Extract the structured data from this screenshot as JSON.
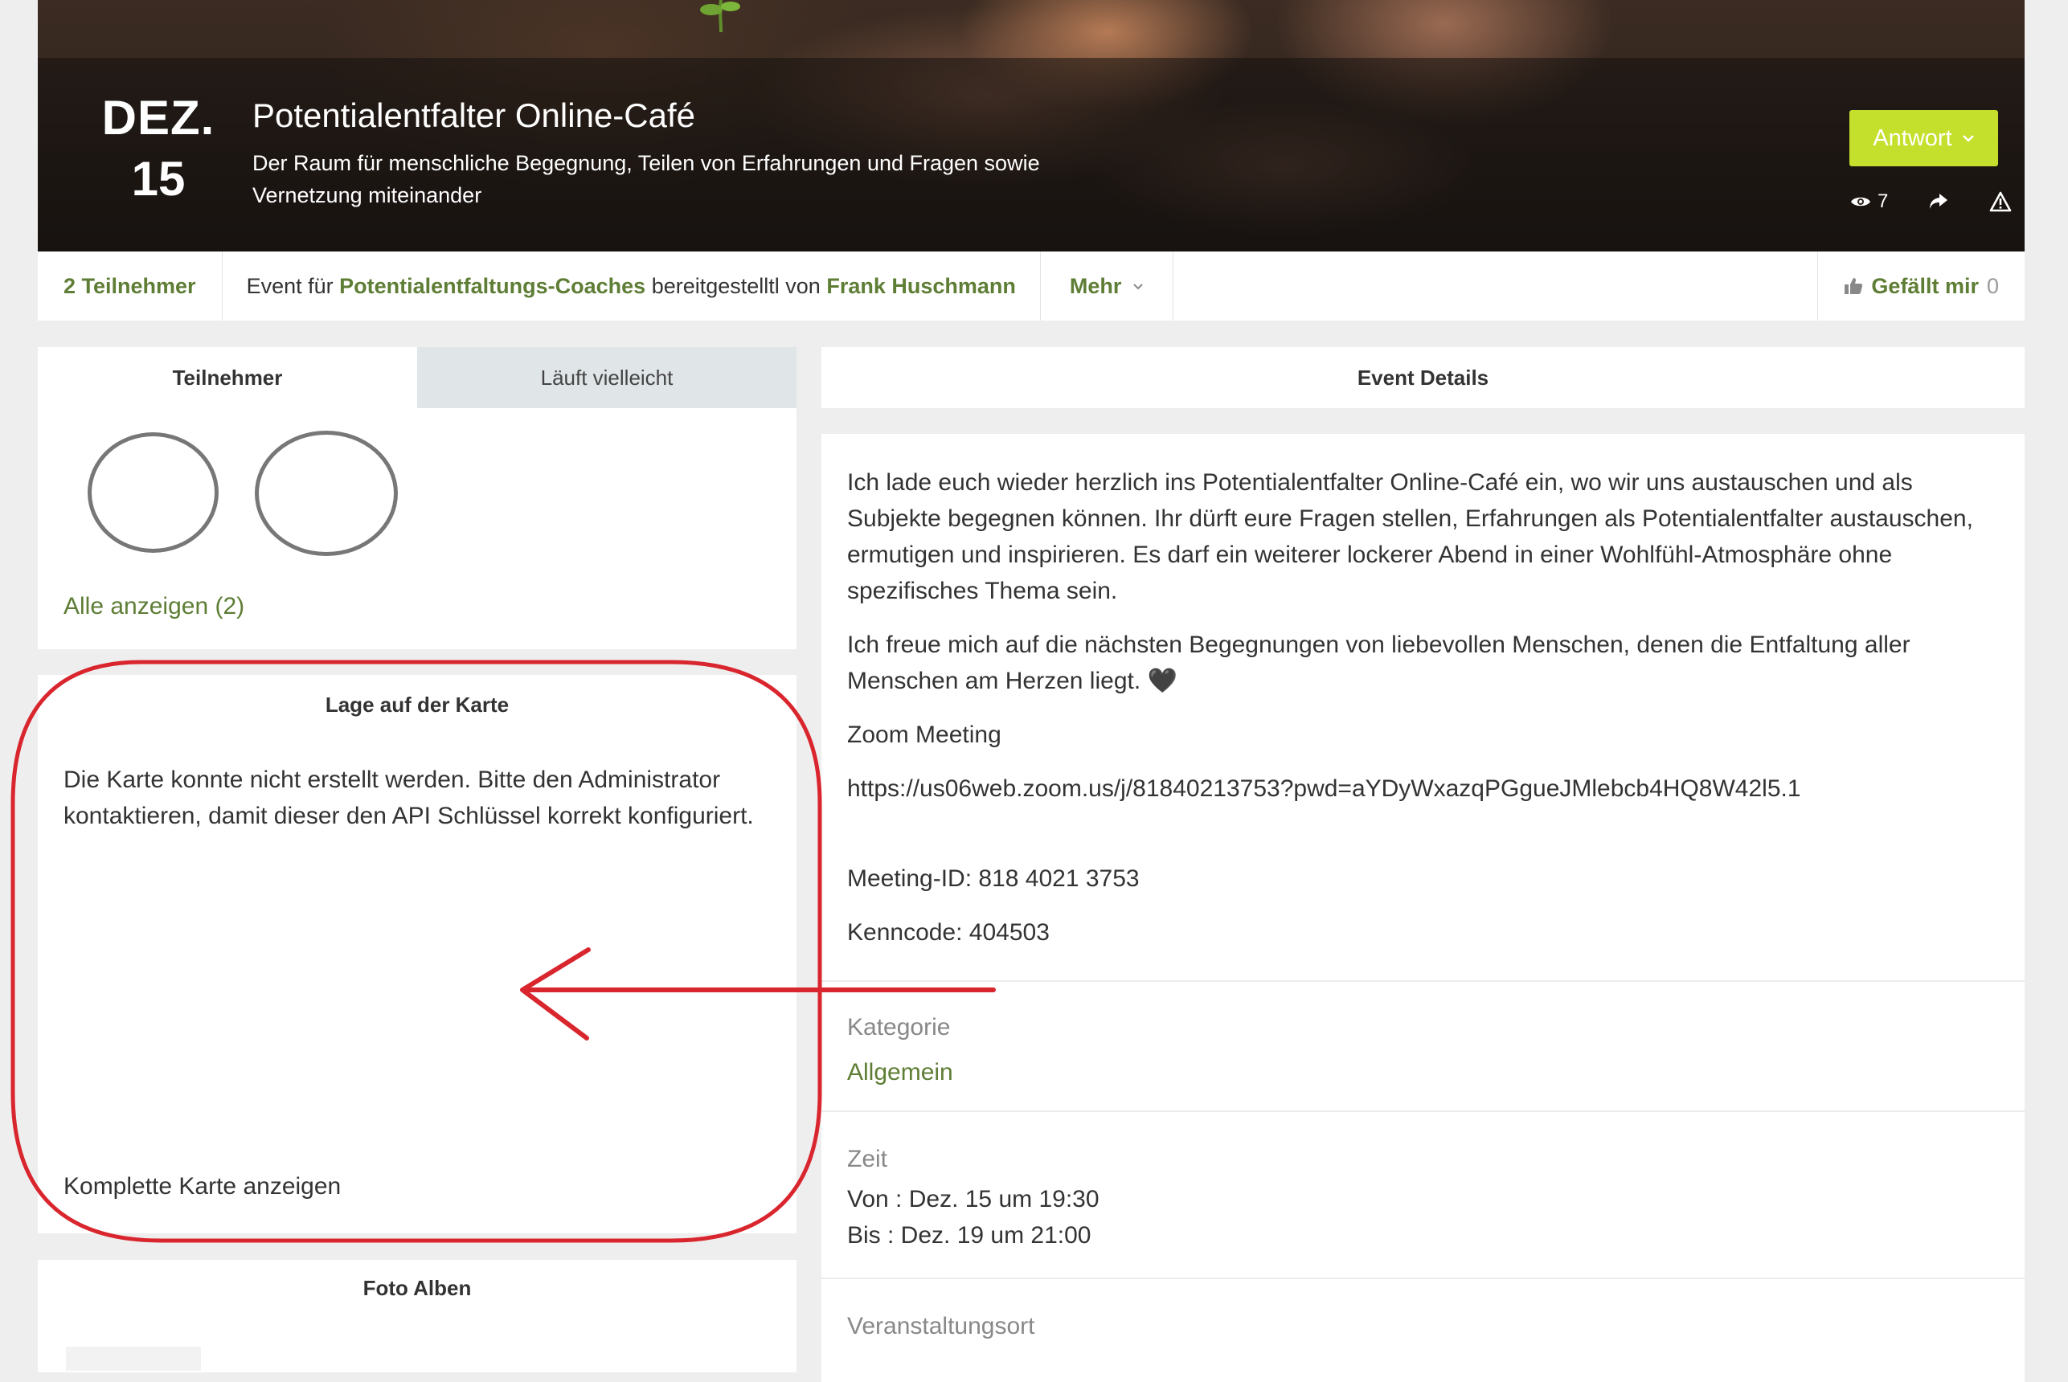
{
  "hero": {
    "date_month": "DEZ.",
    "date_day": "15",
    "title": "Potentialentfalter Online-Café",
    "subtitle": "Der Raum für menschliche Begegnung, Teilen von Erfahrungen und Fragen sowie Vernetzung miteinander",
    "reply_button": "Antwort",
    "view_count": "7"
  },
  "infobar": {
    "participants": "2 Teilnehmer",
    "event_prefix": "Event für",
    "group_name": "Potentialentfaltungs-Coaches",
    "provided_by": "bereitgestelltl von",
    "organizer": "Frank Huschmann",
    "more": "Mehr",
    "like_label": "Gefällt mir",
    "like_count": "0"
  },
  "attendees": {
    "tab_going": "Teilnehmer",
    "tab_maybe": "Läuft vielleicht",
    "show_all": "Alle anzeigen (2)"
  },
  "map": {
    "heading": "Lage auf der Karte",
    "error": "Die Karte konnte nicht erstellt werden. Bitte den Administrator kontaktieren, damit dieser den API Schlüssel korrekt konfiguriert.",
    "full_map_link": "Komplette Karte anzeigen"
  },
  "albums": {
    "heading": "Foto Alben"
  },
  "details": {
    "heading": "Event Details",
    "paragraph1": "Ich lade euch wieder herzlich ins Potentialentfalter Online-Café ein, wo wir uns austauschen und als Subjekte begegnen können. Ihr dürft eure Fragen stellen, Erfahrungen als Potentialentfalter austauschen, ermutigen und inspirieren. Es darf ein weiterer lockerer Abend in einer Wohlfühl-Atmosphäre ohne spezifisches Thema sein.",
    "paragraph2": "Ich freue mich auf die nächsten Begegnungen von liebevollen Menschen, denen die Entfaltung aller Menschen am Herzen liegt. 🖤",
    "zoom_label": "Zoom Meeting",
    "zoom_url": "https://us06web.zoom.us/j/81840213753?pwd=aYDyWxazqPGgueJMlebcb4HQ8W42l5.1",
    "meeting_id": "Meeting-ID: 818 4021 3753",
    "passcode": "Kenncode: 404503",
    "category_label": "Kategorie",
    "category_value": "Allgemein",
    "time_label": "Zeit",
    "time_from": "Von : Dez. 15 um 19:30",
    "time_to": "Bis : Dez. 19 um 21:00",
    "venue_label": "Veranstaltungsort"
  },
  "colors": {
    "accent_green": "#5e7d35",
    "reply_button": "#c5e02c",
    "annotation_red": "#d9262e"
  }
}
